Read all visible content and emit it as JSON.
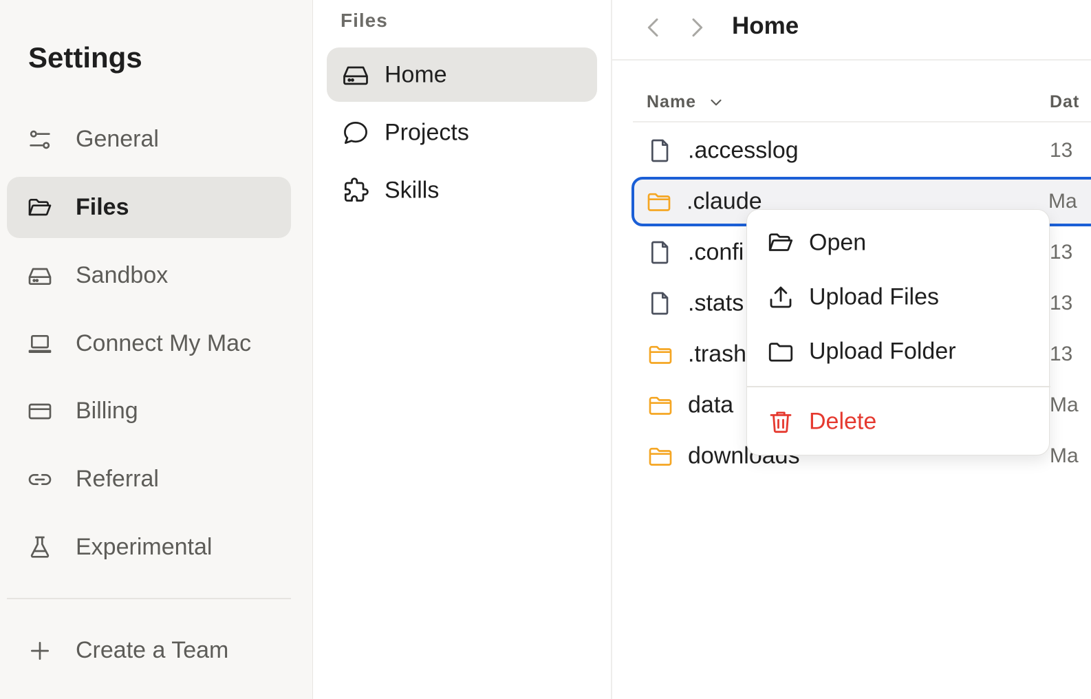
{
  "settings": {
    "title": "Settings",
    "nav": [
      {
        "label": "General",
        "icon": "sliders-icon"
      },
      {
        "label": "Files",
        "icon": "folder-open-icon",
        "active": true
      },
      {
        "label": "Sandbox",
        "icon": "drive-icon"
      },
      {
        "label": "Connect My Mac",
        "icon": "laptop-icon"
      },
      {
        "label": "Billing",
        "icon": "credit-card-icon"
      },
      {
        "label": "Referral",
        "icon": "link-icon"
      },
      {
        "label": "Experimental",
        "icon": "flask-icon"
      }
    ],
    "create_team": {
      "label": "Create a Team",
      "icon": "plus-icon"
    }
  },
  "files_panel": {
    "title": "Files",
    "locations": [
      {
        "label": "Home",
        "icon": "drive-icon",
        "active": true
      },
      {
        "label": "Projects",
        "icon": "chat-bubble-icon"
      },
      {
        "label": "Skills",
        "icon": "puzzle-icon"
      }
    ]
  },
  "browser": {
    "breadcrumb": "Home",
    "columns": {
      "name": "Name",
      "date": "Dat"
    },
    "rows": [
      {
        "name": ".accesslog",
        "type": "file",
        "date": "13"
      },
      {
        "name": ".claude",
        "type": "folder",
        "date": "Ma",
        "selected": true
      },
      {
        "name": ".confi",
        "type": "file",
        "date": "13"
      },
      {
        "name": ".stats",
        "type": "file",
        "date": "13"
      },
      {
        "name": ".trash",
        "type": "folder",
        "date": "13"
      },
      {
        "name": "data",
        "type": "folder",
        "date": "Ma"
      },
      {
        "name": "downloads",
        "type": "folder",
        "date": "Ma"
      }
    ]
  },
  "context_menu": {
    "items": [
      {
        "label": "Open",
        "icon": "folder-open-icon"
      },
      {
        "label": "Upload Files",
        "icon": "upload-icon"
      },
      {
        "label": "Upload Folder",
        "icon": "folder-icon"
      },
      {
        "label": "Delete",
        "icon": "trash-icon",
        "danger": true
      }
    ]
  },
  "colors": {
    "accent": "#1b5fd6",
    "folder": "#f5a623",
    "danger": "#e5392f",
    "sidebar_bg": "#f8f7f5",
    "active_bg": "#e6e5e2"
  }
}
